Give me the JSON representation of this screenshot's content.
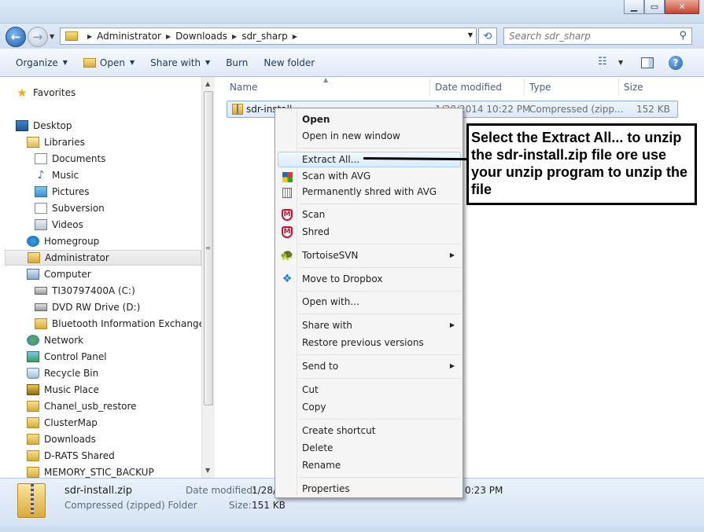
{
  "address": {
    "crumbs": [
      "Administrator",
      "Downloads",
      "sdr_sharp"
    ],
    "search_placeholder": "Search sdr_sharp"
  },
  "toolbar": {
    "organize": "Organize",
    "open": "Open",
    "share_with": "Share with",
    "burn": "Burn",
    "new_folder": "New folder"
  },
  "nav": {
    "favorites": "Favorites",
    "desktop": "Desktop",
    "libraries": "Libraries",
    "documents": "Documents",
    "music": "Music",
    "pictures": "Pictures",
    "subversion": "Subversion",
    "videos": "Videos",
    "homegroup": "Homegroup",
    "administrator": "Administrator",
    "computer": "Computer",
    "drive_c": "TI30797400A (C:)",
    "drive_d": "DVD RW Drive (D:)",
    "bluetooth": "Bluetooth Information Exchanger",
    "network": "Network",
    "control_panel": "Control Panel",
    "recycle_bin": "Recycle Bin",
    "music_place": "Music Place",
    "chanel": "Chanel_usb_restore",
    "clustermap": "ClusterMap",
    "downloads": "Downloads",
    "drats": "D-RATS Shared",
    "memory": "MEMORY_STIC_BACKUP"
  },
  "columns": {
    "name": "Name",
    "date": "Date modified",
    "type": "Type",
    "size": "Size"
  },
  "file": {
    "name": "sdr-install.zip",
    "name_visible": "sdr-install",
    "date": "1/28/2014 10:22 PM",
    "date_visible": "1/28/2014 10:22 PM",
    "type": "Compressed (zipp...",
    "size": "152 KB"
  },
  "status": {
    "filename": "sdr-install.zip",
    "filetype": "Compressed (zipped) Folder",
    "date_label": "Date modified:",
    "date_value": "1/28/",
    "size_label": "Size:",
    "size_value": "151 KB",
    "created_tail": "0:23 PM"
  },
  "context_menu": {
    "open": "Open",
    "open_new_window": "Open in new window",
    "extract_all": "Extract All...",
    "scan_avg": "Scan with AVG",
    "shred_avg": "Permanently shred with AVG",
    "scan": "Scan",
    "shred": "Shred",
    "tortoise": "TortoiseSVN",
    "dropbox": "Move to Dropbox",
    "open_with": "Open with...",
    "share_with": "Share with",
    "restore": "Restore previous versions",
    "send_to": "Send to",
    "cut": "Cut",
    "copy": "Copy",
    "create_shortcut": "Create shortcut",
    "delete": "Delete",
    "rename": "Rename",
    "properties": "Properties"
  },
  "callout": {
    "text": "Select the Extract All... to unzip the sdr-install.zip file ore use your unzip program to unzip the file"
  },
  "colors": {
    "accent": "#1f5ea8",
    "highlight": "#dbeaf9",
    "mcafee": "#c8102e"
  }
}
